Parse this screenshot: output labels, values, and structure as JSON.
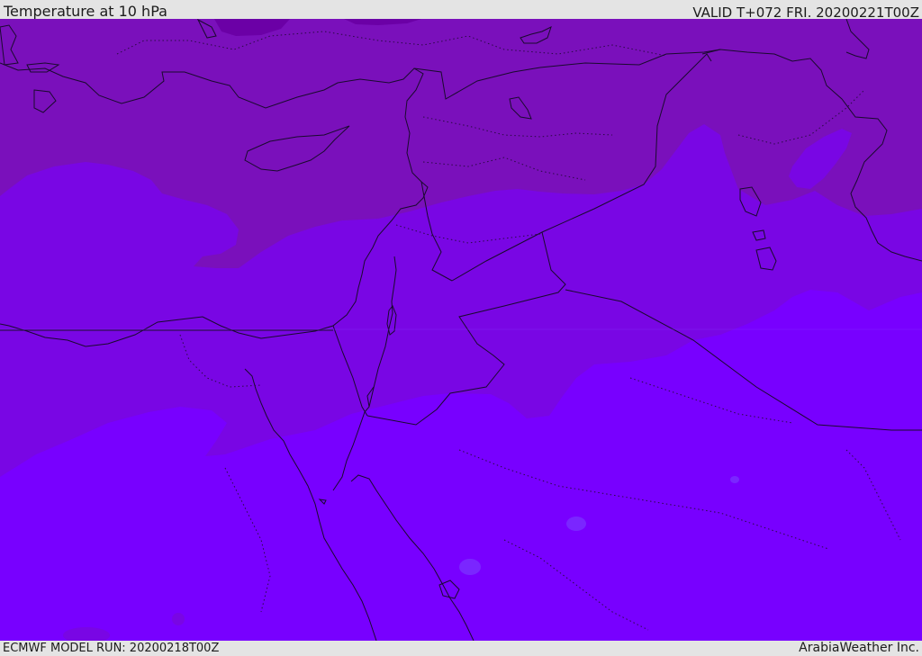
{
  "header": {
    "title": "Temperature at 10 hPa",
    "valid": "VALID T+072 FRI. 20200221T00Z"
  },
  "footer": {
    "model_run": "ECMWF MODEL RUN: 20200218T00Z",
    "credit": "ArabiaWeather Inc."
  },
  "map": {
    "region": "Eastern Mediterranean and Middle East",
    "colors": {
      "warmest_fill": "#7800ff",
      "mid_fill": "#7906e4",
      "cool_fill": "#7a10bb",
      "coldest_fill": "#6b00a6",
      "boundary_line": "#1a0a2e"
    }
  }
}
